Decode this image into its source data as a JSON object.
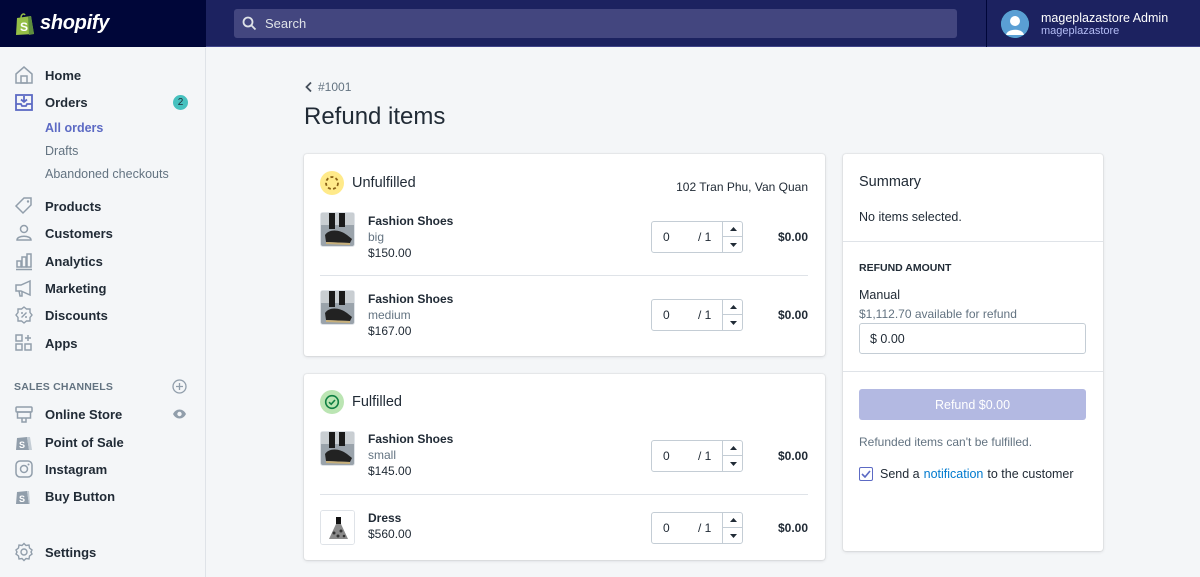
{
  "topbar": {
    "logo_text": "shopify",
    "search_placeholder": "Search",
    "user_name": "mageplazastore Admin",
    "user_store": "mageplazastore"
  },
  "sidebar": {
    "items": [
      {
        "label": "Home",
        "icon": "home-icon"
      },
      {
        "label": "Orders",
        "icon": "orders-icon",
        "badge": "2"
      },
      {
        "label": "Products",
        "icon": "tag-icon"
      },
      {
        "label": "Customers",
        "icon": "customer-icon"
      },
      {
        "label": "Analytics",
        "icon": "analytics-icon"
      },
      {
        "label": "Marketing",
        "icon": "megaphone-icon"
      },
      {
        "label": "Discounts",
        "icon": "discount-icon"
      },
      {
        "label": "Apps",
        "icon": "apps-icon"
      }
    ],
    "orders_sub": [
      {
        "label": "All orders",
        "active": true
      },
      {
        "label": "Drafts"
      },
      {
        "label": "Abandoned checkouts"
      }
    ],
    "sales_channels_heading": "SALES CHANNELS",
    "channels": [
      {
        "label": "Online Store",
        "icon": "store-icon"
      },
      {
        "label": "Point of Sale",
        "icon": "pos-bag-icon"
      },
      {
        "label": "Instagram",
        "icon": "instagram-icon"
      },
      {
        "label": "Buy Button",
        "icon": "buy-button-bag-icon"
      }
    ],
    "settings_label": "Settings"
  },
  "page": {
    "back_label": "#1001",
    "title": "Refund items"
  },
  "unfulfilled": {
    "title": "Unfulfilled",
    "address": "102 Tran Phu, Van Quan",
    "items": [
      {
        "name": "Fashion Shoes",
        "variant": "big",
        "price": "$150.00",
        "qty": "0",
        "max": "/ 1",
        "amount": "$0.00"
      },
      {
        "name": "Fashion Shoes",
        "variant": "medium",
        "price": "$167.00",
        "qty": "0",
        "max": "/ 1",
        "amount": "$0.00"
      }
    ]
  },
  "fulfilled": {
    "title": "Fulfilled",
    "items": [
      {
        "name": "Fashion Shoes",
        "variant": "small",
        "price": "$145.00",
        "qty": "0",
        "max": "/ 1",
        "amount": "$0.00"
      },
      {
        "name": "Dress",
        "price": "$560.00",
        "qty": "0",
        "max": "/ 1",
        "amount": "$0.00"
      }
    ]
  },
  "summary": {
    "title": "Summary",
    "empty_text": "No items selected.",
    "refund_amount_heading": "REFUND AMOUNT",
    "manual_label": "Manual",
    "available_text": "$1,112.70 available for refund",
    "amount_value": "$ 0.00",
    "refund_button": "Refund $0.00",
    "refund_note": "Refunded items can't be fulfilled.",
    "notify_prefix": "Send a",
    "notify_link": "notification",
    "notify_suffix": "to the customer",
    "notify_checked": true
  },
  "colors": {
    "topbar": "#1c2260",
    "logo_bg": "#000639",
    "accent": "#5c6ac4",
    "badge": "#47c1bf",
    "unfulfilled": "#ffea8a",
    "fulfilled": "#bbe5b3",
    "link": "#007ace"
  }
}
